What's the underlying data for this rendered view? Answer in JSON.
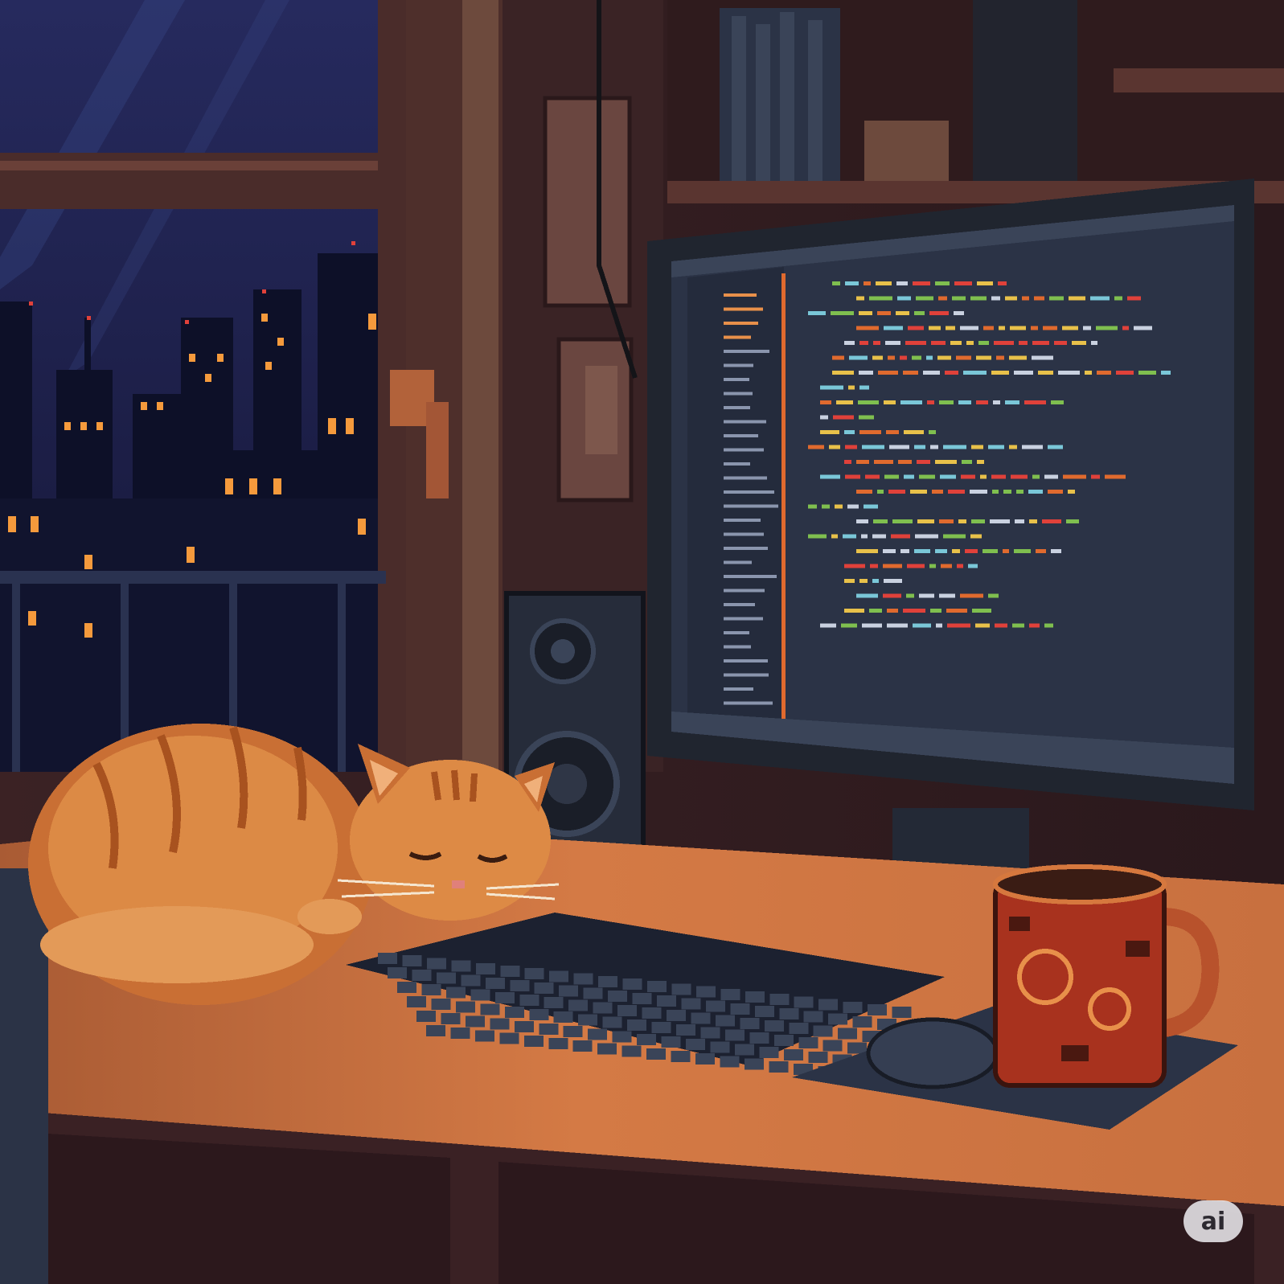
{
  "scene": {
    "subject": "cat",
    "palette": {
      "night_sky": "#1c1f4e",
      "window_glow": "#f59a3c",
      "wood_dark": "#3a2322",
      "wood_mid": "#5a3530",
      "desk_top": "#c56f3e",
      "cat_fur": "#d98a45",
      "screen_bg": "#2b3346",
      "code_red": "#e0413a",
      "code_green": "#7fbf4f",
      "code_yellow": "#e8c14a",
      "code_cyan": "#7ac7d8",
      "mug_red": "#a8321e"
    },
    "icons": [
      "cat-icon",
      "monitor-icon",
      "keyboard-icon",
      "mug-icon",
      "mouse-icon",
      "speaker-icon"
    ]
  },
  "watermark": {
    "label": "ai"
  }
}
